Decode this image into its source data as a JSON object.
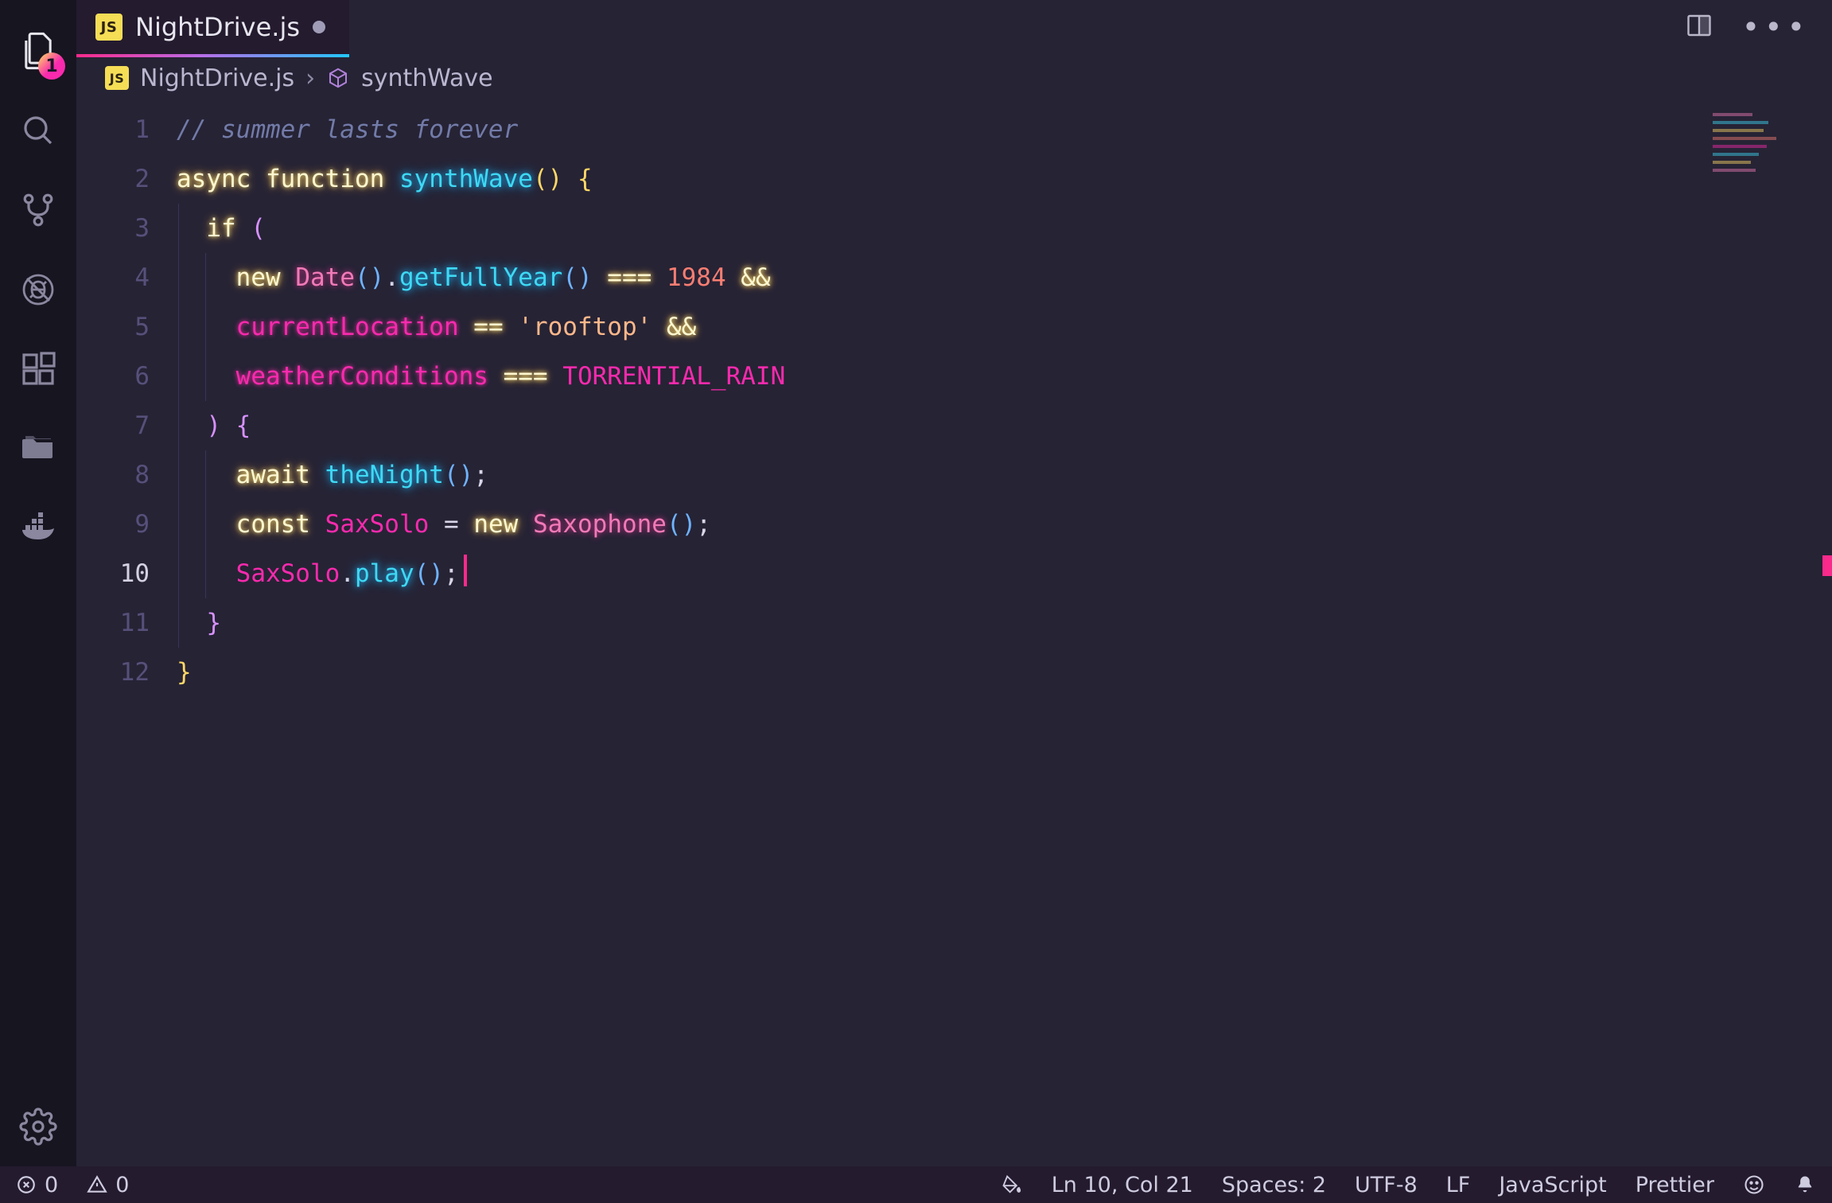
{
  "activityBar": {
    "explorerBadge": "1"
  },
  "tab": {
    "fileLang": "JS",
    "fileName": "NightDrive.js"
  },
  "breadcrumb": {
    "fileLang": "JS",
    "fileName": "NightDrive.js",
    "symbol": "synthWave"
  },
  "editor": {
    "currentLine": 10,
    "lines": [
      {
        "n": "1",
        "tokens": [
          {
            "c": "tok-comment",
            "t": "// summer lasts forever"
          }
        ]
      },
      {
        "n": "2",
        "tokens": [
          {
            "c": "tok-keyword",
            "t": "async"
          },
          {
            "t": " "
          },
          {
            "c": "tok-keyword",
            "t": "function"
          },
          {
            "t": " "
          },
          {
            "c": "tok-func",
            "t": "synthWave"
          },
          {
            "c": "tok-paren-g",
            "t": "()"
          },
          {
            "t": " "
          },
          {
            "c": "tok-paren-g",
            "t": "{"
          }
        ]
      },
      {
        "n": "3",
        "tokens": [
          {
            "t": "  "
          },
          {
            "c": "tok-keyword",
            "t": "if"
          },
          {
            "t": " "
          },
          {
            "c": "tok-paren-p",
            "t": "("
          }
        ]
      },
      {
        "n": "4",
        "tokens": [
          {
            "t": "    "
          },
          {
            "c": "tok-keyword",
            "t": "new"
          },
          {
            "t": " "
          },
          {
            "c": "tok-class",
            "t": "Date"
          },
          {
            "c": "tok-paren-b",
            "t": "()"
          },
          {
            "c": "tok-punct",
            "t": "."
          },
          {
            "c": "tok-func",
            "t": "getFullYear"
          },
          {
            "c": "tok-paren-b",
            "t": "()"
          },
          {
            "t": " "
          },
          {
            "c": "tok-op",
            "t": "==="
          },
          {
            "t": " "
          },
          {
            "c": "tok-num",
            "t": "1984"
          },
          {
            "t": " "
          },
          {
            "c": "tok-op",
            "t": "&&"
          }
        ]
      },
      {
        "n": "5",
        "tokens": [
          {
            "t": "    "
          },
          {
            "c": "tok-ident",
            "t": "currentLocation"
          },
          {
            "t": " "
          },
          {
            "c": "tok-op",
            "t": "=="
          },
          {
            "t": " "
          },
          {
            "c": "tok-string",
            "t": "'rooftop'"
          },
          {
            "t": " "
          },
          {
            "c": "tok-op",
            "t": "&&"
          }
        ]
      },
      {
        "n": "6",
        "tokens": [
          {
            "t": "    "
          },
          {
            "c": "tok-ident",
            "t": "weatherConditions"
          },
          {
            "t": " "
          },
          {
            "c": "tok-op",
            "t": "==="
          },
          {
            "t": " "
          },
          {
            "c": "tok-const",
            "t": "TORRENTIAL_RAIN"
          }
        ]
      },
      {
        "n": "7",
        "tokens": [
          {
            "t": "  "
          },
          {
            "c": "tok-paren-p",
            "t": ")"
          },
          {
            "t": " "
          },
          {
            "c": "tok-paren-p",
            "t": "{"
          }
        ]
      },
      {
        "n": "8",
        "tokens": [
          {
            "t": "    "
          },
          {
            "c": "tok-keyword",
            "t": "await"
          },
          {
            "t": " "
          },
          {
            "c": "tok-func",
            "t": "theNight"
          },
          {
            "c": "tok-paren-b",
            "t": "()"
          },
          {
            "c": "tok-punct",
            "t": ";"
          }
        ]
      },
      {
        "n": "9",
        "tokens": [
          {
            "t": "    "
          },
          {
            "c": "tok-keyword",
            "t": "const"
          },
          {
            "t": " "
          },
          {
            "c": "tok-var",
            "t": "SaxSolo"
          },
          {
            "t": " "
          },
          {
            "c": "tok-punct",
            "t": "="
          },
          {
            "t": " "
          },
          {
            "c": "tok-keyword",
            "t": "new"
          },
          {
            "t": " "
          },
          {
            "c": "tok-class",
            "t": "Saxophone"
          },
          {
            "c": "tok-paren-b",
            "t": "()"
          },
          {
            "c": "tok-punct",
            "t": ";"
          }
        ]
      },
      {
        "n": "10",
        "tokens": [
          {
            "t": "    "
          },
          {
            "c": "tok-var",
            "t": "SaxSolo"
          },
          {
            "c": "tok-punct",
            "t": "."
          },
          {
            "c": "tok-func",
            "t": "play"
          },
          {
            "c": "tok-paren-b",
            "t": "()"
          },
          {
            "c": "tok-punct",
            "t": ";"
          }
        ],
        "cursor": true
      },
      {
        "n": "11",
        "tokens": [
          {
            "t": "  "
          },
          {
            "c": "tok-paren-p",
            "t": "}"
          }
        ]
      },
      {
        "n": "12",
        "tokens": [
          {
            "c": "tok-paren-g",
            "t": "}"
          }
        ]
      }
    ]
  },
  "status": {
    "errors": "0",
    "warnings": "0",
    "lnCol": "Ln 10, Col 21",
    "spaces": "Spaces: 2",
    "encoding": "UTF-8",
    "eol": "LF",
    "language": "JavaScript",
    "formatter": "Prettier"
  }
}
